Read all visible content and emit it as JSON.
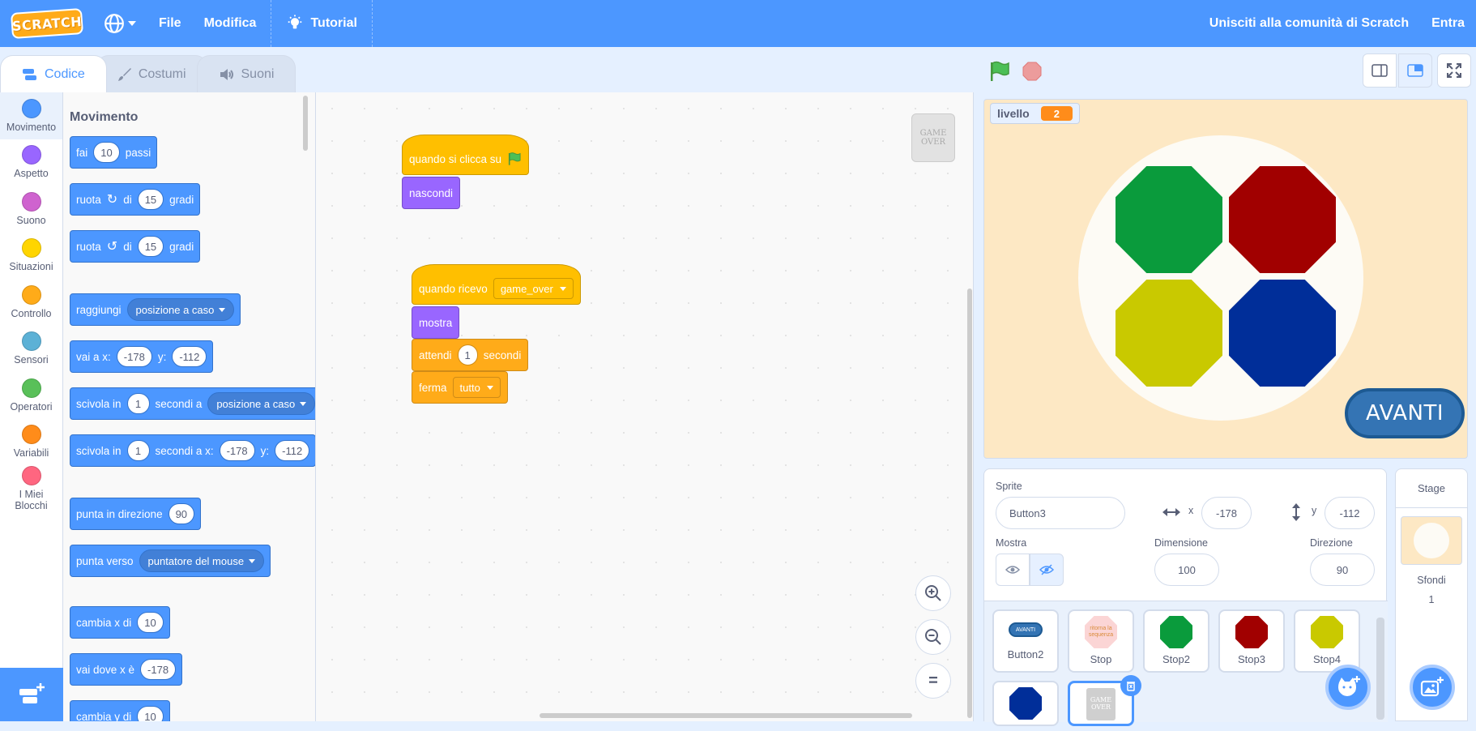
{
  "menubar": {
    "logo": "SCRATCH",
    "file": "File",
    "edit": "Modifica",
    "tutorial": "Tutorial",
    "join": "Unisciti alla comunità di Scratch",
    "signin": "Entra",
    "bg_color": "#4c97ff"
  },
  "tabs": [
    {
      "label": "Codice",
      "active": true
    },
    {
      "label": "Costumi",
      "active": false
    },
    {
      "label": "Suoni",
      "active": false
    }
  ],
  "categories": [
    {
      "label": "Movimento",
      "color": "#4c97ff"
    },
    {
      "label": "Aspetto",
      "color": "#9966ff"
    },
    {
      "label": "Suono",
      "color": "#cf63cf"
    },
    {
      "label": "Situazioni",
      "color": "#ffd500"
    },
    {
      "label": "Controllo",
      "color": "#ffab19"
    },
    {
      "label": "Sensori",
      "color": "#5cb1d6"
    },
    {
      "label": "Operatori",
      "color": "#59c059"
    },
    {
      "label": "Variabili",
      "color": "#ff8c1a"
    },
    {
      "label": "I Miei Blocchi",
      "color": "#ff6680"
    }
  ],
  "palette": {
    "title": "Movimento",
    "move": {
      "a": "fai",
      "n": "10",
      "b": "passi"
    },
    "turn_right": {
      "a": "ruota",
      "b": "di",
      "n": "15",
      "c": "gradi"
    },
    "turn_left": {
      "a": "ruota",
      "b": "di",
      "n": "15",
      "c": "gradi"
    },
    "goto": {
      "a": "raggiungi",
      "dd": "posizione a caso"
    },
    "gotoxy": {
      "a": "vai a x:",
      "x": "-178",
      "b": "y:",
      "y": "-112"
    },
    "glide": {
      "a": "scivola in",
      "n": "1",
      "b": "secondi a",
      "dd": "posizione a caso"
    },
    "glidexy": {
      "a": "scivola in",
      "n": "1",
      "b": "secondi a x:",
      "x": "-178",
      "c": "y:",
      "y": "-112"
    },
    "point_dir": {
      "a": "punta in direzione",
      "n": "90"
    },
    "point_towards": {
      "a": "punta verso",
      "dd": "puntatore del mouse"
    },
    "change_x": {
      "a": "cambia x di",
      "n": "10"
    },
    "set_x": {
      "a": "vai dove x è",
      "n": "-178"
    },
    "change_y": {
      "a": "cambia y di",
      "n": "10"
    }
  },
  "scripts": {
    "s1": {
      "hat": "quando si clicca su",
      "b1": "nascondi"
    },
    "s2": {
      "hat": "quando ricevo",
      "msg": "game_over",
      "b1": "mostra",
      "wait_a": "attendi",
      "wait_n": "1",
      "wait_b": "secondi",
      "stop": "ferma",
      "stop_dd": "tutto"
    },
    "corner_thumb": "GAME OVER"
  },
  "stage": {
    "monitor_label": "livello",
    "monitor_value": "2",
    "button_label": "AVANTI",
    "colors": {
      "green": "#0a9b3c",
      "red": "#a10000",
      "yellow": "#c9c900",
      "blue": "#002e99",
      "bg": "#fde8c4"
    }
  },
  "sprite_info": {
    "sprite_label": "Sprite",
    "sprite_name": "Button3",
    "x_label": "x",
    "x_value": "-178",
    "y_label": "y",
    "y_value": "-112",
    "show_label": "Mostra",
    "size_label": "Dimensione",
    "size_value": "100",
    "direction_label": "Direzione",
    "direction_value": "90"
  },
  "sprites": [
    {
      "name": "Button2",
      "thumb": "AVANTI"
    },
    {
      "name": "Stop",
      "thumb": "ritorna la sequenza"
    },
    {
      "name": "Stop2",
      "color": "#0a9b3c"
    },
    {
      "name": "Stop3",
      "color": "#a10000"
    },
    {
      "name": "Stop4",
      "color": "#c9c900"
    },
    {
      "name": "",
      "color": "#002e99"
    },
    {
      "name": "",
      "thumb": "GAME OVER",
      "selected": true
    }
  ],
  "stage_pane": {
    "title": "Stage",
    "backdrops_label": "Sfondi",
    "backdrops_count": "1"
  }
}
